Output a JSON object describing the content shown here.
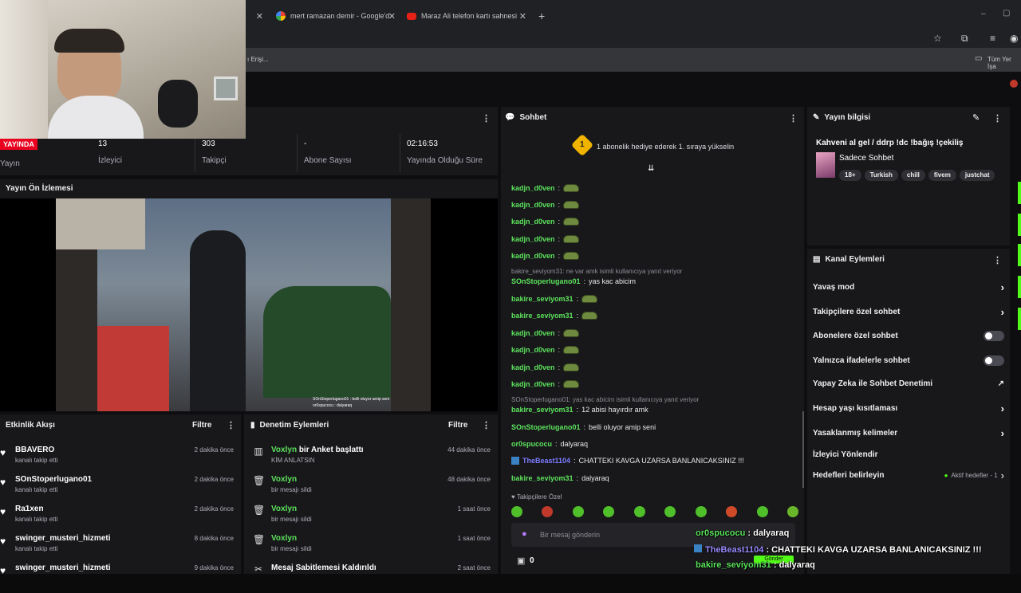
{
  "browser": {
    "tabs": [
      {
        "label": "mert ramazan demir - Google'd"
      },
      {
        "label": "Maraz Ali telefon kartı sahnesi"
      }
    ],
    "new_tab": "+",
    "bookmark_left": "ı Erişi...",
    "bookmark_right": "Tüm Yer İşa"
  },
  "stats": {
    "live_badge": "YAYINDA",
    "live_label": "Yayın",
    "viewers": {
      "value": "13",
      "label": "İzleyici"
    },
    "followers": {
      "value": "303",
      "label": "Takipçi"
    },
    "subs": {
      "value": "-",
      "label": "Abone Sayısı"
    },
    "uptime": {
      "value": "02:16:53",
      "label": "Yayında Olduğu Süre"
    }
  },
  "preview": {
    "title": "Yayın Ön İzlemesi",
    "video_caption_1": "SOnStoperlugano01 : belli oluyor amip seni",
    "video_caption_2": "or0spucocu : dalyaraq"
  },
  "activity": {
    "title": "Etkinlik Akışı",
    "filter": "Filtre",
    "items": [
      {
        "name": "BBAVERO",
        "sub": "kanalı takip etti",
        "time": "2 dakika önce"
      },
      {
        "name": "SOnStoperlugano01",
        "sub": "kanalı takip etti",
        "time": "2 dakika önce"
      },
      {
        "name": "Ra1xen",
        "sub": "kanalı takip etti",
        "time": "2 dakika önce"
      },
      {
        "name": "swinger_musteri_hizmeti",
        "sub": "kanalı takip etti",
        "time": "8 dakika önce"
      },
      {
        "name": "swinger_musteri_hizmeti",
        "sub": "",
        "time": "9 dakika önce"
      }
    ]
  },
  "moderation": {
    "title": "Denetim Eylemleri",
    "filter": "Filtre",
    "items": [
      {
        "icon": "poll-icon",
        "name_user": "Voxlyn",
        "name_rest": " bir Anket başlattı",
        "sub": "KİM ANLATSIN",
        "time": "44 dakika önce"
      },
      {
        "icon": "trash-icon",
        "name_user": "Voxlyn",
        "name_rest": "",
        "sub": "bir mesajı sildi",
        "time": "48 dakika önce"
      },
      {
        "icon": "trash-icon",
        "name_user": "Voxlyn",
        "name_rest": "",
        "sub": "bir mesajı sildi",
        "time": "1 saat önce"
      },
      {
        "icon": "trash-icon",
        "name_user": "Voxlyn",
        "name_rest": "",
        "sub": "bir mesajı sildi",
        "time": "1 saat önce"
      },
      {
        "icon": "unpin-icon",
        "name_user": "",
        "name_rest": "Mesaj Sabitlemesi Kaldırıldı",
        "sub": "",
        "time": "2 saat önce"
      }
    ]
  },
  "chat": {
    "title": "Sohbet",
    "hype_badge": "1",
    "hype_text": "1 abonelik hediye ederek 1. sıraya yükselin",
    "followers_only": "Takipçilere Özel",
    "input_placeholder": "Bir mesaj gönderin",
    "points": "0",
    "colors": {
      "green": "#5ce35c",
      "blue_user": "#7b7bff"
    },
    "lines": [
      {
        "user": "kadjn_d0ven",
        "text": "",
        "emote": true
      },
      {
        "user": "kadjn_d0ven",
        "text": "",
        "emote": true
      },
      {
        "user": "kadjn_d0ven",
        "text": "",
        "emote": true
      },
      {
        "user": "kadjn_d0ven",
        "text": "",
        "emote": true
      },
      {
        "user": "kadjn_d0ven",
        "text": "",
        "emote": true
      },
      {
        "user": "SOnStoperlugano01",
        "text": " yas kac abicim",
        "emote": false
      },
      {
        "user": "bakire_seviyom31",
        "text": "",
        "emote": true
      },
      {
        "user": "bakire_seviyom31",
        "text": "",
        "emote": true
      },
      {
        "user": "kadjn_d0ven",
        "text": "",
        "emote": true
      },
      {
        "user": "kadjn_d0ven",
        "text": "",
        "emote": true
      },
      {
        "user": "kadjn_d0ven",
        "text": "",
        "emote": true
      },
      {
        "user": "kadjn_d0ven",
        "text": "",
        "emote": true
      },
      {
        "user": "bakire_seviyom31",
        "text": " 12 abisi hayırdır amk",
        "emote": false
      },
      {
        "user": "SOnStoperlugano01",
        "text": " belli oluyor amip seni",
        "emote": false
      },
      {
        "user": "or0spucocu",
        "text": " dalyaraq",
        "emote": false
      },
      {
        "user": "TheBeast1104",
        "text": " CHATTEKI KAVGA UZARSA BANLANICAKSINIZ !!!",
        "emote": false
      },
      {
        "user": "bakire_seviyom31",
        "text": " dalyaraq",
        "emote": false
      }
    ],
    "reply_1": "bakire_seviyom31: ne var amk isimli kullanıcıya yanıt veriyor",
    "reply_2": "SOnStoperlugano01: yas kac abicim isimli kullanıcıya yanıt veriyor"
  },
  "stream_info": {
    "title": "Yayın bilgisi",
    "stream_title": "Kahveni al gel / ddrp !dc !bağış !çekiliş",
    "category": "Sadece Sohbet",
    "tags": [
      "18+",
      "Turkish",
      "chill",
      "fivem",
      "justchat"
    ]
  },
  "channel_actions": {
    "title": "Kanal Eylemleri",
    "slow_mode": "Yavaş mod",
    "followers_chat": "Takipçilere özel sohbet",
    "subs_chat": "Abonelere özel sohbet",
    "emote_chat": "Yalnızca ifadelerle sohbet",
    "ai_mod": "Yapay Zeka ile Sohbet Denetimi",
    "age_limit": "Hesap yaşı kısıtlaması",
    "banned_words": "Yasaklanmış kelimeler",
    "viewer_redirect": "İzleyici Yönlendir",
    "set_goals": "Hedefleri belirleyin",
    "active_goals": "Aktif hedefler - 1"
  },
  "overlay": {
    "line1_user": "or0spucocu",
    "line1_text": " : dalyaraq",
    "line2_user": "TheBeast1104",
    "line2_text": " : CHATTEKI KAVGA UZARSA BANLANICAKSINIZ !!!",
    "line3_user": "bakire_seviyom31",
    "line3_text": " : dalyaraq",
    "badge_label": "Gönder"
  }
}
